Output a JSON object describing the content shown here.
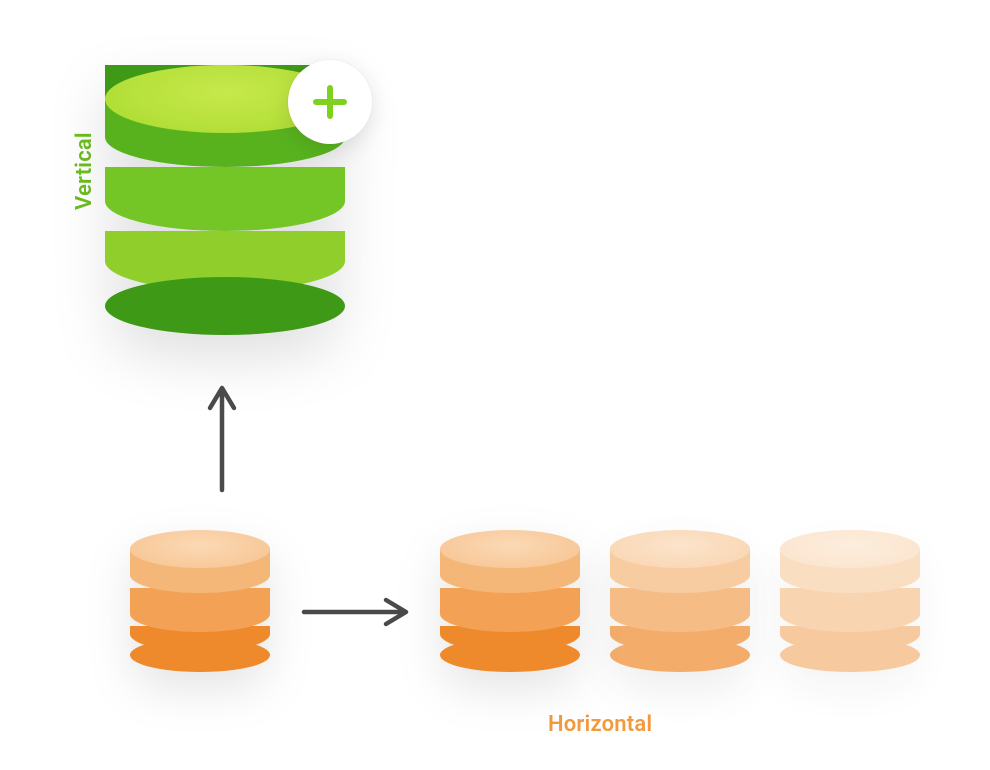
{
  "labels": {
    "vertical": "Vertical",
    "horizontal": "Horizontal"
  },
  "colors": {
    "vertical_label": "#6CBE1F",
    "horizontal_label": "#F19A3E",
    "plus_icon": "#7FD11F",
    "arrow": "#4A4A4A",
    "green_bands": [
      "#B7E13C",
      "#8FCE2B",
      "#74C626",
      "#58B21E",
      "#3E9A16"
    ],
    "orange_bands": [
      "#F8C99A",
      "#F5B778",
      "#F3A154",
      "#EE8A2B"
    ]
  },
  "diagram": {
    "concept": "database-scaling",
    "vertical": {
      "description": "scale-up-single-node",
      "action_icon": "plus"
    },
    "horizontal": {
      "description": "scale-out-replicas",
      "source_node_count": 1,
      "replica_node_count": 3
    }
  }
}
